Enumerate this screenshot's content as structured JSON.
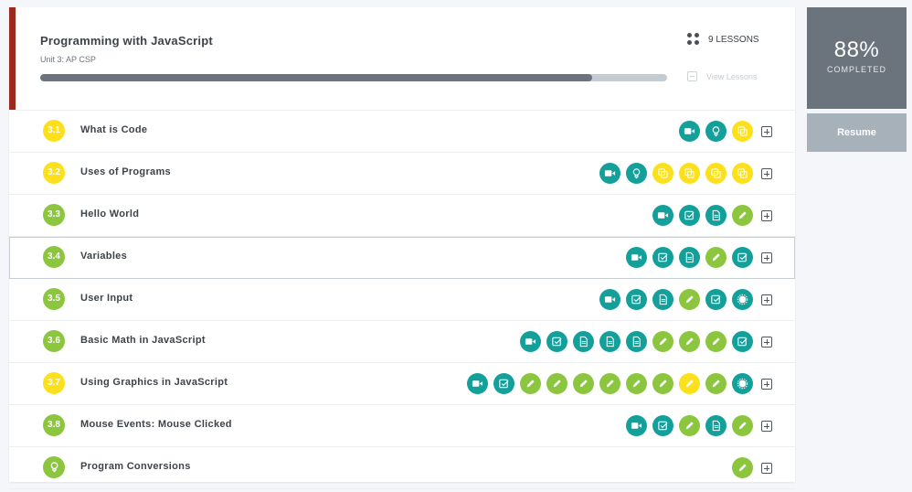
{
  "unit": {
    "title": "Programming with JavaScript",
    "subtitle": "Unit 3: AP CSP",
    "lessons_count": "9 LESSONS",
    "view_lessons": "View Lessons",
    "progress": 0.88,
    "accent_color": "#9b2a1d"
  },
  "summary": {
    "percent": "88%",
    "label": "COMPLETED",
    "resume": "Resume"
  },
  "colors": {
    "teal": "#139f9a",
    "green": "#8cc63f",
    "yellow": "#fde01c"
  },
  "lessons": [
    {
      "num": "3.1",
      "title": "What is Code",
      "color": "yellow",
      "activities": [
        [
          "video",
          "teal"
        ],
        [
          "bulb",
          "teal"
        ],
        [
          "quiz",
          "yellow"
        ]
      ]
    },
    {
      "num": "3.2",
      "title": "Uses of Programs",
      "color": "yellow",
      "activities": [
        [
          "video",
          "teal"
        ],
        [
          "bulb",
          "teal"
        ],
        [
          "quiz",
          "yellow"
        ],
        [
          "quiz",
          "yellow"
        ],
        [
          "quiz",
          "yellow"
        ],
        [
          "quiz",
          "yellow"
        ]
      ]
    },
    {
      "num": "3.3",
      "title": "Hello World",
      "color": "green",
      "activities": [
        [
          "video",
          "teal"
        ],
        [
          "check",
          "teal"
        ],
        [
          "doc",
          "teal"
        ],
        [
          "pencil",
          "green"
        ]
      ]
    },
    {
      "num": "3.4",
      "title": "Variables",
      "color": "green",
      "highlight": true,
      "activities": [
        [
          "video",
          "teal"
        ],
        [
          "check",
          "teal"
        ],
        [
          "doc",
          "teal"
        ],
        [
          "pencil",
          "green"
        ],
        [
          "check",
          "teal"
        ]
      ]
    },
    {
      "num": "3.5",
      "title": "User Input",
      "color": "green",
      "activities": [
        [
          "video",
          "teal"
        ],
        [
          "check",
          "teal"
        ],
        [
          "doc",
          "teal"
        ],
        [
          "pencil",
          "green"
        ],
        [
          "check",
          "teal"
        ],
        [
          "badge",
          "teal"
        ]
      ]
    },
    {
      "num": "3.6",
      "title": "Basic Math in JavaScript",
      "color": "green",
      "activities": [
        [
          "video",
          "teal"
        ],
        [
          "check",
          "teal"
        ],
        [
          "doc",
          "teal"
        ],
        [
          "doc",
          "teal"
        ],
        [
          "doc",
          "teal"
        ],
        [
          "pencil",
          "green"
        ],
        [
          "pencil",
          "green"
        ],
        [
          "pencil",
          "green"
        ],
        [
          "check",
          "teal"
        ]
      ]
    },
    {
      "num": "3.7",
      "title": "Using Graphics in JavaScript",
      "color": "yellow",
      "activities": [
        [
          "video",
          "teal"
        ],
        [
          "check",
          "teal"
        ],
        [
          "pencil",
          "green"
        ],
        [
          "pencil",
          "green"
        ],
        [
          "pencil",
          "green"
        ],
        [
          "pencil",
          "green"
        ],
        [
          "pencil",
          "green"
        ],
        [
          "pencil",
          "green"
        ],
        [
          "pencil",
          "yellow"
        ],
        [
          "pencil",
          "green"
        ],
        [
          "badge",
          "teal"
        ]
      ]
    },
    {
      "num": "3.8",
      "title": "Mouse Events: Mouse Clicked",
      "color": "green",
      "activities": [
        [
          "video",
          "teal"
        ],
        [
          "check",
          "teal"
        ],
        [
          "pencil",
          "green"
        ],
        [
          "doc",
          "teal"
        ],
        [
          "pencil",
          "green"
        ]
      ]
    },
    {
      "num": "",
      "title": "Program Conversions",
      "color": "green",
      "icon": "bulb",
      "activities": [
        [
          "pencil",
          "green"
        ]
      ]
    }
  ]
}
